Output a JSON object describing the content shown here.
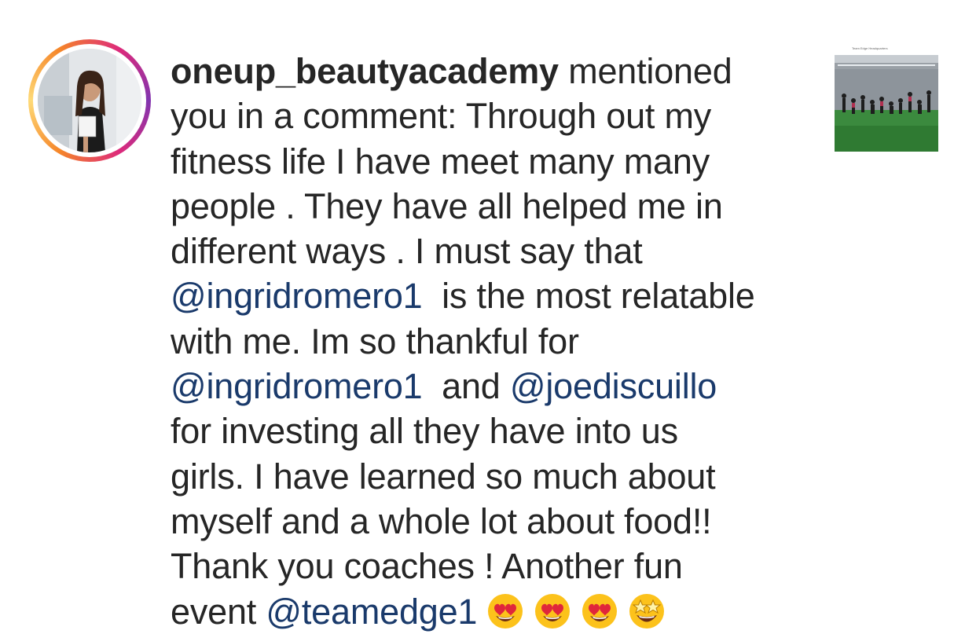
{
  "notification": {
    "username": "oneup_beautyacademy",
    "lines": [
      " mentioned",
      "you in a comment: Through out my",
      "fitness life I have meet many many",
      "people . They have all helped me in",
      "different ways . I must say that"
    ],
    "mention_1": "@ingridromero1",
    "line_6_rest": "  is the most relatable",
    "line_7": "with me. Im so thankful for",
    "mention_2": "@ingridromero1",
    "line_8_mid": "  and ",
    "mention_3": "@joediscuillo",
    "lines_b": [
      "for investing all they have into us",
      "girls. I have learned so much about",
      "myself and a whole lot about food!!",
      "Thank you coaches ! Another fun"
    ],
    "line_last_prefix": "event ",
    "mention_4": "@teamedge1",
    "emojis": [
      "heart-eyes",
      "heart-eyes",
      "heart-eyes",
      "star-struck"
    ],
    "thumbnail_caption": "Team Edge Headquarters"
  },
  "colors": {
    "text": "#262626",
    "mention": "#1a3a6b",
    "ring_start": "#f58529",
    "ring_end": "#dd2a7b"
  }
}
